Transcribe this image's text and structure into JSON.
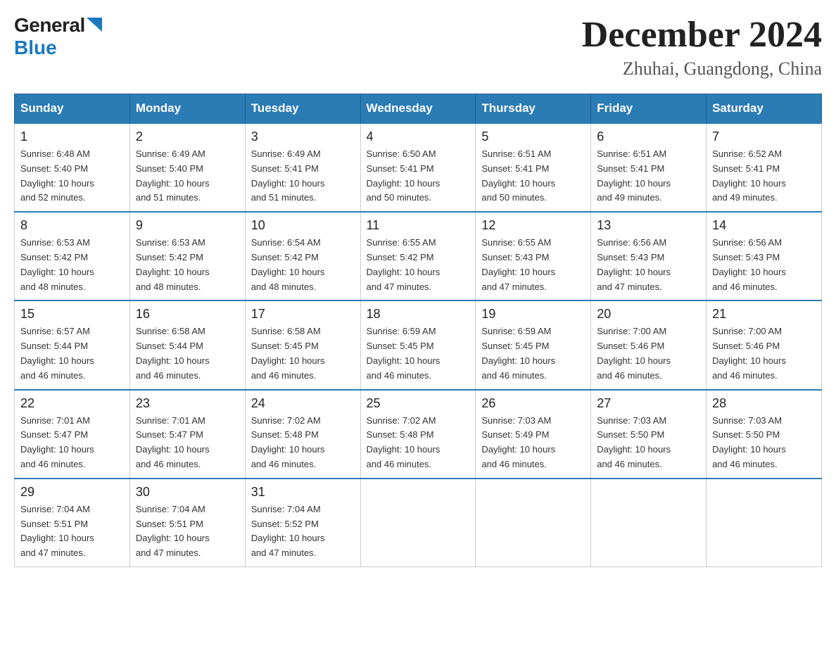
{
  "logo": {
    "general": "General",
    "blue": "Blue"
  },
  "title": "December 2024",
  "subtitle": "Zhuhai, Guangdong, China",
  "days_of_week": [
    "Sunday",
    "Monday",
    "Tuesday",
    "Wednesday",
    "Thursday",
    "Friday",
    "Saturday"
  ],
  "weeks": [
    [
      {
        "day": "1",
        "sunrise": "6:48 AM",
        "sunset": "5:40 PM",
        "daylight": "10 hours and 52 minutes."
      },
      {
        "day": "2",
        "sunrise": "6:49 AM",
        "sunset": "5:40 PM",
        "daylight": "10 hours and 51 minutes."
      },
      {
        "day": "3",
        "sunrise": "6:49 AM",
        "sunset": "5:41 PM",
        "daylight": "10 hours and 51 minutes."
      },
      {
        "day": "4",
        "sunrise": "6:50 AM",
        "sunset": "5:41 PM",
        "daylight": "10 hours and 50 minutes."
      },
      {
        "day": "5",
        "sunrise": "6:51 AM",
        "sunset": "5:41 PM",
        "daylight": "10 hours and 50 minutes."
      },
      {
        "day": "6",
        "sunrise": "6:51 AM",
        "sunset": "5:41 PM",
        "daylight": "10 hours and 49 minutes."
      },
      {
        "day": "7",
        "sunrise": "6:52 AM",
        "sunset": "5:41 PM",
        "daylight": "10 hours and 49 minutes."
      }
    ],
    [
      {
        "day": "8",
        "sunrise": "6:53 AM",
        "sunset": "5:42 PM",
        "daylight": "10 hours and 48 minutes."
      },
      {
        "day": "9",
        "sunrise": "6:53 AM",
        "sunset": "5:42 PM",
        "daylight": "10 hours and 48 minutes."
      },
      {
        "day": "10",
        "sunrise": "6:54 AM",
        "sunset": "5:42 PM",
        "daylight": "10 hours and 48 minutes."
      },
      {
        "day": "11",
        "sunrise": "6:55 AM",
        "sunset": "5:42 PM",
        "daylight": "10 hours and 47 minutes."
      },
      {
        "day": "12",
        "sunrise": "6:55 AM",
        "sunset": "5:43 PM",
        "daylight": "10 hours and 47 minutes."
      },
      {
        "day": "13",
        "sunrise": "6:56 AM",
        "sunset": "5:43 PM",
        "daylight": "10 hours and 47 minutes."
      },
      {
        "day": "14",
        "sunrise": "6:56 AM",
        "sunset": "5:43 PM",
        "daylight": "10 hours and 46 minutes."
      }
    ],
    [
      {
        "day": "15",
        "sunrise": "6:57 AM",
        "sunset": "5:44 PM",
        "daylight": "10 hours and 46 minutes."
      },
      {
        "day": "16",
        "sunrise": "6:58 AM",
        "sunset": "5:44 PM",
        "daylight": "10 hours and 46 minutes."
      },
      {
        "day": "17",
        "sunrise": "6:58 AM",
        "sunset": "5:45 PM",
        "daylight": "10 hours and 46 minutes."
      },
      {
        "day": "18",
        "sunrise": "6:59 AM",
        "sunset": "5:45 PM",
        "daylight": "10 hours and 46 minutes."
      },
      {
        "day": "19",
        "sunrise": "6:59 AM",
        "sunset": "5:45 PM",
        "daylight": "10 hours and 46 minutes."
      },
      {
        "day": "20",
        "sunrise": "7:00 AM",
        "sunset": "5:46 PM",
        "daylight": "10 hours and 46 minutes."
      },
      {
        "day": "21",
        "sunrise": "7:00 AM",
        "sunset": "5:46 PM",
        "daylight": "10 hours and 46 minutes."
      }
    ],
    [
      {
        "day": "22",
        "sunrise": "7:01 AM",
        "sunset": "5:47 PM",
        "daylight": "10 hours and 46 minutes."
      },
      {
        "day": "23",
        "sunrise": "7:01 AM",
        "sunset": "5:47 PM",
        "daylight": "10 hours and 46 minutes."
      },
      {
        "day": "24",
        "sunrise": "7:02 AM",
        "sunset": "5:48 PM",
        "daylight": "10 hours and 46 minutes."
      },
      {
        "day": "25",
        "sunrise": "7:02 AM",
        "sunset": "5:48 PM",
        "daylight": "10 hours and 46 minutes."
      },
      {
        "day": "26",
        "sunrise": "7:03 AM",
        "sunset": "5:49 PM",
        "daylight": "10 hours and 46 minutes."
      },
      {
        "day": "27",
        "sunrise": "7:03 AM",
        "sunset": "5:50 PM",
        "daylight": "10 hours and 46 minutes."
      },
      {
        "day": "28",
        "sunrise": "7:03 AM",
        "sunset": "5:50 PM",
        "daylight": "10 hours and 46 minutes."
      }
    ],
    [
      {
        "day": "29",
        "sunrise": "7:04 AM",
        "sunset": "5:51 PM",
        "daylight": "10 hours and 47 minutes."
      },
      {
        "day": "30",
        "sunrise": "7:04 AM",
        "sunset": "5:51 PM",
        "daylight": "10 hours and 47 minutes."
      },
      {
        "day": "31",
        "sunrise": "7:04 AM",
        "sunset": "5:52 PM",
        "daylight": "10 hours and 47 minutes."
      },
      null,
      null,
      null,
      null
    ]
  ],
  "labels": {
    "sunrise": "Sunrise:",
    "sunset": "Sunset:",
    "daylight": "Daylight:"
  }
}
